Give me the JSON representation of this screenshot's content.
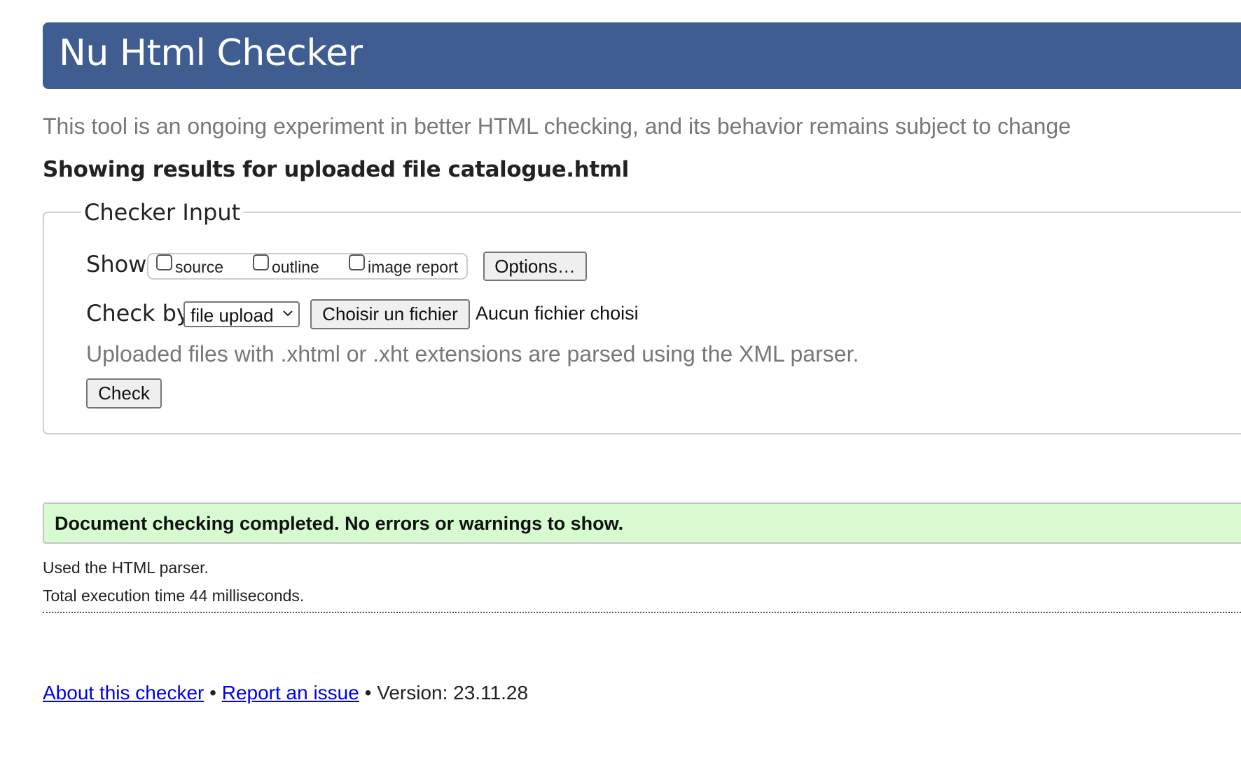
{
  "header": {
    "title": "Nu Html Checker"
  },
  "intro_text": "This tool is an ongoing experiment in better HTML checking, and its behavior remains subject to change",
  "results_heading": "Showing results for uploaded file catalogue.html",
  "checker_input": {
    "legend": "Checker Input",
    "show_label": "Show",
    "show_options": [
      {
        "label": "source",
        "checked": false
      },
      {
        "label": "outline",
        "checked": false
      },
      {
        "label": "image report",
        "checked": false
      }
    ],
    "options_button": "Options…",
    "check_by_label": "Check by",
    "check_by_select": {
      "selected": "file upload"
    },
    "file_button": "Choisir un fichier",
    "file_status": "Aucun fichier choisi",
    "note": "Uploaded files with .xhtml or .xht extensions are parsed using the XML parser.",
    "check_button": "Check"
  },
  "result": {
    "message": "Document checking completed. No errors or warnings to show.",
    "color": "#d7fad0"
  },
  "stats": {
    "parser": "Used the HTML parser.",
    "execution_time": "Total execution time 44 milliseconds."
  },
  "footer": {
    "about_link": "About this checker",
    "separator": "•",
    "report_link": "Report an issue",
    "version": "Version: 23.11.28"
  },
  "colors": {
    "header": "#405d92",
    "link": "#0000ee",
    "muted_text": "#777777"
  }
}
